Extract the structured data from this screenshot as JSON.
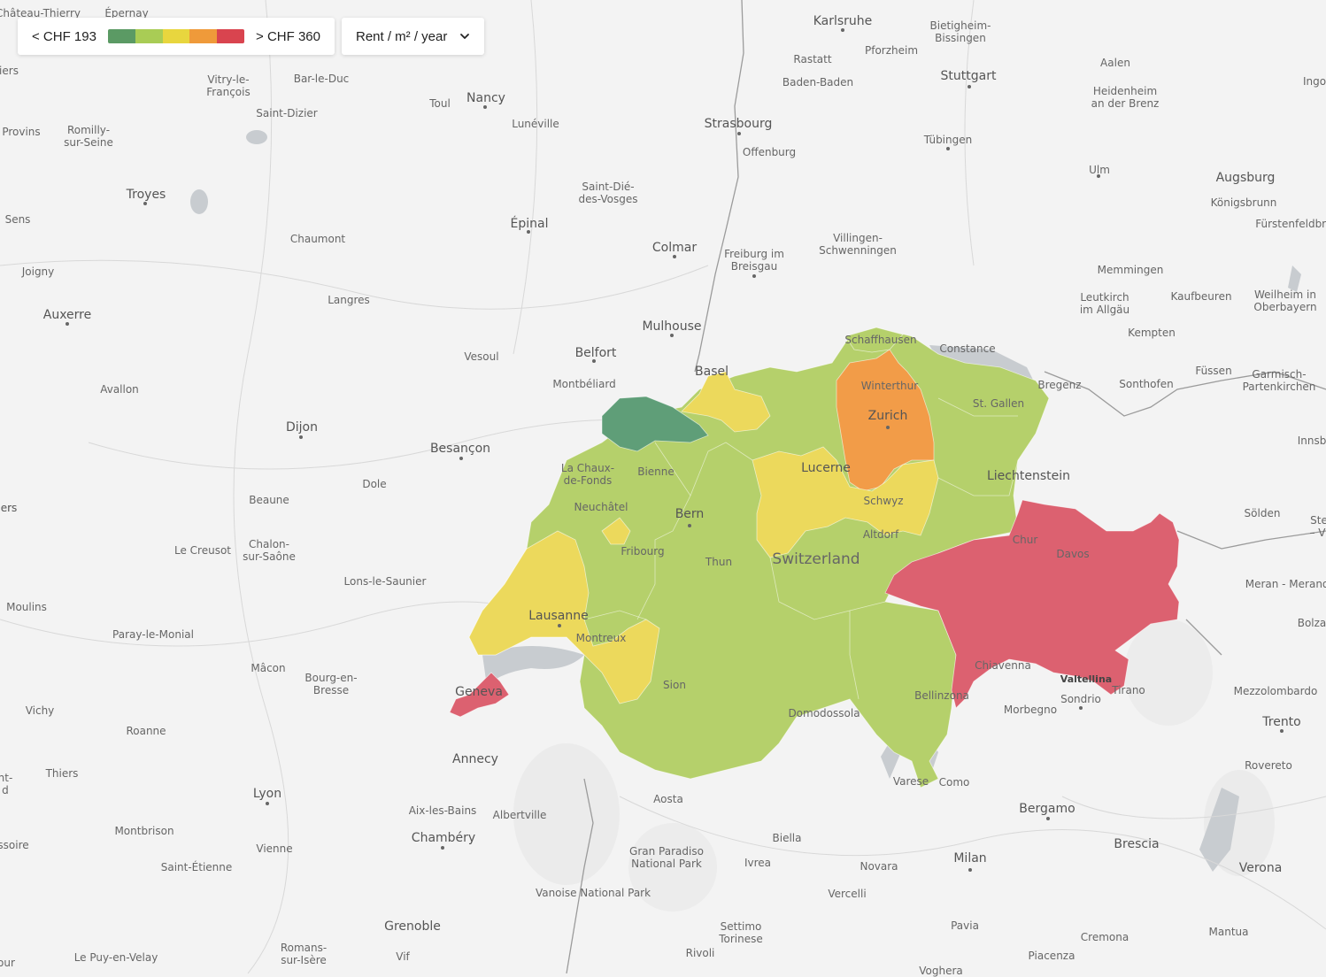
{
  "legend": {
    "min_label": "< CHF 193",
    "max_label": "> CHF 360",
    "colors": [
      "#5b9a64",
      "#a9cc55",
      "#e8d63e",
      "#ef9a3a",
      "#d9444f"
    ]
  },
  "metric_select": {
    "value": "Rent / m² / year"
  },
  "map_colors": {
    "background": "#f3f3f3",
    "dark_green": "#5f9e78",
    "light_green": "#b5d06b",
    "yellow": "#ecd95c",
    "orange": "#f29c48",
    "red": "#dc6170"
  },
  "cities": [
    {
      "id": "chateau-thierry",
      "name": "Château-Thierry"
    },
    {
      "id": "epernay",
      "name": "Épernay"
    },
    {
      "id": "karlsruhe",
      "name": "Karlsruhe"
    },
    {
      "id": "bietigheim",
      "name": "Bietigheim-\nBissingen"
    },
    {
      "id": "pforzheim",
      "name": "Pforzheim"
    },
    {
      "id": "rastatt",
      "name": "Rastatt"
    },
    {
      "id": "aalen",
      "name": "Aalen"
    },
    {
      "id": "ingo",
      "name": "Ingo"
    },
    {
      "id": "stuttgart",
      "name": "Stuttgart"
    },
    {
      "id": "heidenheim",
      "name": "Heidenheim\nan der Brenz"
    },
    {
      "id": "vitry",
      "name": "Vitry-le-\nFrançois"
    },
    {
      "id": "bar-le-duc",
      "name": "Bar-le-Duc"
    },
    {
      "id": "nancy",
      "name": "Nancy"
    },
    {
      "id": "toul",
      "name": "Toul"
    },
    {
      "id": "baden-baden",
      "name": "Baden-Baden"
    },
    {
      "id": "saint-dizier",
      "name": "Saint-Dizier"
    },
    {
      "id": "luneville",
      "name": "Lunéville"
    },
    {
      "id": "strasbourg",
      "name": "Strasbourg"
    },
    {
      "id": "provins",
      "name": "Provins"
    },
    {
      "id": "romilly",
      "name": "Romilly-\nsur-Seine"
    },
    {
      "id": "tubingen",
      "name": "Tübingen"
    },
    {
      "id": "offenburg",
      "name": "Offenburg"
    },
    {
      "id": "ulm",
      "name": "Ulm"
    },
    {
      "id": "augsburg",
      "name": "Augsburg"
    },
    {
      "id": "troyes",
      "name": "Troyes"
    },
    {
      "id": "saint-die",
      "name": "Saint-Dié-\ndes-Vosges"
    },
    {
      "id": "konigsbrunn",
      "name": "Königsbrunn"
    },
    {
      "id": "sens",
      "name": "Sens"
    },
    {
      "id": "epinal",
      "name": "Épinal"
    },
    {
      "id": "furstenfeld",
      "name": "Fürstenfeldbru"
    },
    {
      "id": "chaumont",
      "name": "Chaumont"
    },
    {
      "id": "colmar",
      "name": "Colmar"
    },
    {
      "id": "villingen",
      "name": "Villingen-\nSchwenningen"
    },
    {
      "id": "freiburg",
      "name": "Freiburg im\nBreisgau"
    },
    {
      "id": "memmingen",
      "name": "Memmingen"
    },
    {
      "id": "joigny",
      "name": "Joigny"
    },
    {
      "id": "kaufbeuren",
      "name": "Kaufbeuren"
    },
    {
      "id": "leutkirch",
      "name": "Leutkirch\nim Allgäu"
    },
    {
      "id": "weilheim",
      "name": "Weilheim in\nOberbayern"
    },
    {
      "id": "langres",
      "name": "Langres"
    },
    {
      "id": "auxerre",
      "name": "Auxerre"
    },
    {
      "id": "mulhouse",
      "name": "Mulhouse"
    },
    {
      "id": "schaffhausen",
      "name": "Schaffhausen"
    },
    {
      "id": "kempten",
      "name": "Kempten"
    },
    {
      "id": "constance",
      "name": "Constance"
    },
    {
      "id": "belfort",
      "name": "Belfort"
    },
    {
      "id": "vesoul",
      "name": "Vesoul"
    },
    {
      "id": "basel",
      "name": "Basel"
    },
    {
      "id": "fussen",
      "name": "Füssen"
    },
    {
      "id": "garmisch",
      "name": "Garmisch-\nPartenkirchen"
    },
    {
      "id": "avallon",
      "name": "Avallon"
    },
    {
      "id": "montbeliard",
      "name": "Montbéliard"
    },
    {
      "id": "winterthur",
      "name": "Winterthur"
    },
    {
      "id": "bregenz",
      "name": "Bregenz"
    },
    {
      "id": "sonthofen",
      "name": "Sonthofen"
    },
    {
      "id": "st-gallen",
      "name": "St. Gallen"
    },
    {
      "id": "zurich",
      "name": "Zurich"
    },
    {
      "id": "innsb",
      "name": "Innsb"
    },
    {
      "id": "dijon",
      "name": "Dijon"
    },
    {
      "id": "besancon",
      "name": "Besançon"
    },
    {
      "id": "la-chaux",
      "name": "La Chaux-\nde-Fonds"
    },
    {
      "id": "biel",
      "name": "Bienne"
    },
    {
      "id": "lucerne",
      "name": "Lucerne"
    },
    {
      "id": "liechtenstein",
      "name": "Liechtenstein"
    },
    {
      "id": "dole",
      "name": "Dole"
    },
    {
      "id": "schwyz",
      "name": "Schwyz"
    },
    {
      "id": "neuchatel",
      "name": "Neuchâtel"
    },
    {
      "id": "beaune",
      "name": "Beaune"
    },
    {
      "id": "bern",
      "name": "Bern"
    },
    {
      "id": "solden",
      "name": "Sölden"
    },
    {
      "id": "ste",
      "name": "Ste\n– Vi"
    },
    {
      "id": "ers",
      "name": "ers"
    },
    {
      "id": "altdorf",
      "name": "Altdorf"
    },
    {
      "id": "chur",
      "name": "Chur"
    },
    {
      "id": "le-creusot",
      "name": "Le Creusot"
    },
    {
      "id": "chalon",
      "name": "Chalon-\nsur-Saône"
    },
    {
      "id": "fribourg",
      "name": "Fribourg"
    },
    {
      "id": "davos",
      "name": "Davos"
    },
    {
      "id": "thun",
      "name": "Thun"
    },
    {
      "id": "lons",
      "name": "Lons-le-Saunier"
    },
    {
      "id": "meran",
      "name": "Meran - Merano"
    },
    {
      "id": "moulins",
      "name": "Moulins"
    },
    {
      "id": "lausanne",
      "name": "Lausanne"
    },
    {
      "id": "bolza",
      "name": "Bolza"
    },
    {
      "id": "paray",
      "name": "Paray-le-Monial"
    },
    {
      "id": "montreux",
      "name": "Montreux"
    },
    {
      "id": "chiavenna",
      "name": "Chiavenna"
    },
    {
      "id": "macon",
      "name": "Mâcon"
    },
    {
      "id": "bourg",
      "name": "Bourg-en-\nBresse"
    },
    {
      "id": "valtellina",
      "name": "Valtellina"
    },
    {
      "id": "tirano",
      "name": "Tirano"
    },
    {
      "id": "sion",
      "name": "Sion"
    },
    {
      "id": "geneva",
      "name": "Geneva"
    },
    {
      "id": "mezzolombardo",
      "name": "Mezzolombardo"
    },
    {
      "id": "bellinzona",
      "name": "Bellinzona"
    },
    {
      "id": "sondrio",
      "name": "Sondrio"
    },
    {
      "id": "vichy",
      "name": "Vichy"
    },
    {
      "id": "morbegno",
      "name": "Morbegno"
    },
    {
      "id": "domodossola",
      "name": "Domodossola"
    },
    {
      "id": "trento",
      "name": "Trento"
    },
    {
      "id": "roanne",
      "name": "Roanne"
    },
    {
      "id": "annecy",
      "name": "Annecy"
    },
    {
      "id": "rovereto",
      "name": "Rovereto"
    },
    {
      "id": "thiers",
      "name": "Thiers"
    },
    {
      "id": "nt-d",
      "name": "nt-\nd"
    },
    {
      "id": "varese",
      "name": "Varese"
    },
    {
      "id": "como",
      "name": "Como"
    },
    {
      "id": "lyon",
      "name": "Lyon"
    },
    {
      "id": "aosta",
      "name": "Aosta"
    },
    {
      "id": "bergamo",
      "name": "Bergamo"
    },
    {
      "id": "aix",
      "name": "Aix-les-Bains"
    },
    {
      "id": "albertville",
      "name": "Albertville"
    },
    {
      "id": "montbrison",
      "name": "Montbrison"
    },
    {
      "id": "chambery",
      "name": "Chambéry"
    },
    {
      "id": "biella",
      "name": "Biella"
    },
    {
      "id": "ssoire",
      "name": "ssoire"
    },
    {
      "id": "vienne",
      "name": "Vienne"
    },
    {
      "id": "brescia",
      "name": "Brescia"
    },
    {
      "id": "gran-paradiso",
      "name": "Gran Paradiso\nNational Park"
    },
    {
      "id": "milan",
      "name": "Milan"
    },
    {
      "id": "ivrea",
      "name": "Ivrea"
    },
    {
      "id": "novara",
      "name": "Novara"
    },
    {
      "id": "verona",
      "name": "Verona"
    },
    {
      "id": "saint-etienne",
      "name": "Saint-Étienne"
    },
    {
      "id": "vanoise",
      "name": "Vanoise National Park"
    },
    {
      "id": "vercelli",
      "name": "Vercelli"
    },
    {
      "id": "grenoble",
      "name": "Grenoble"
    },
    {
      "id": "settimo",
      "name": "Settimo\nTorinese"
    },
    {
      "id": "pavia",
      "name": "Pavia"
    },
    {
      "id": "mantua",
      "name": "Mantua"
    },
    {
      "id": "cremona",
      "name": "Cremona"
    },
    {
      "id": "romans",
      "name": "Romans-\nsur-Isère"
    },
    {
      "id": "le-puy",
      "name": "Le Puy-en-Velay"
    },
    {
      "id": "rivoli",
      "name": "Rivoli"
    },
    {
      "id": "piacenza",
      "name": "Piacenza"
    },
    {
      "id": "vif",
      "name": "Vif"
    },
    {
      "id": "voghera",
      "name": "Voghera"
    },
    {
      "id": "iers",
      "name": "iers"
    },
    {
      "id": "ers2",
      "name": "ers"
    },
    {
      "id": "our",
      "name": "our"
    }
  ],
  "country_label": "Switzerland"
}
